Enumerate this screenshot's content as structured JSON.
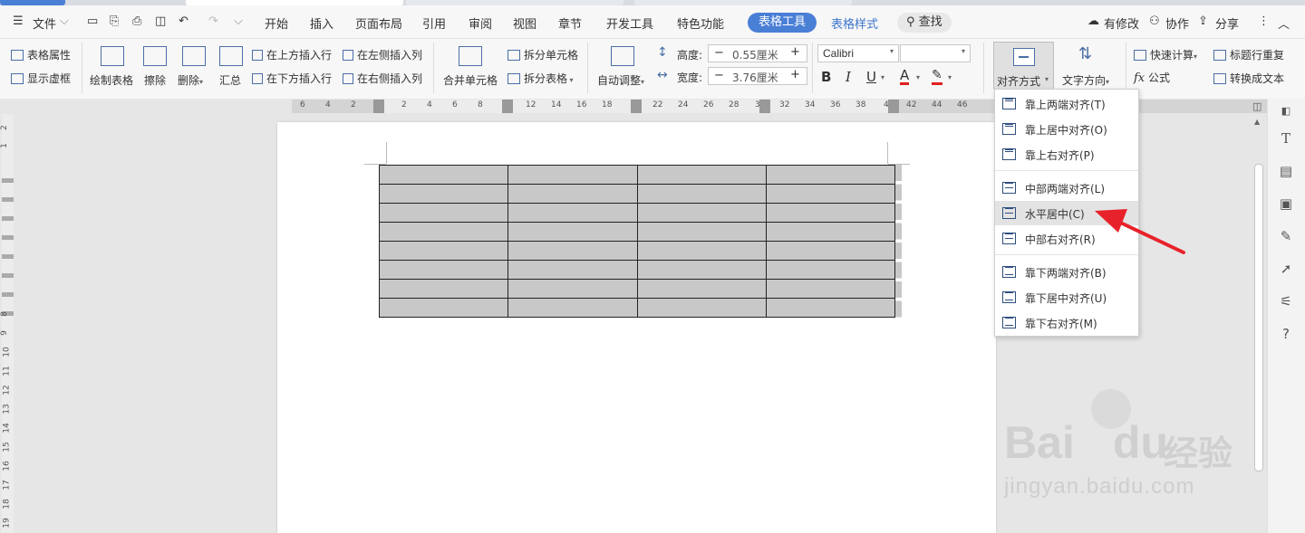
{
  "menubar": {
    "file": "文件",
    "items": [
      "开始",
      "插入",
      "页面布局",
      "引用",
      "审阅",
      "视图",
      "章节",
      "开发工具",
      "特色功能"
    ],
    "active_tab": "表格工具",
    "tab_table_style": "表格样式",
    "search": "查找",
    "has_changes": "有修改",
    "collaborate": "协作",
    "share": "分享"
  },
  "ribbon": {
    "table_props": "表格属性",
    "show_gridlines": "显示虚框",
    "draw_table": "绘制表格",
    "erase": "擦除",
    "delete": "删除",
    "summary": "汇总",
    "insert_row_above": "在上方插入行",
    "insert_row_below": "在下方插入行",
    "insert_col_left": "在左侧插入列",
    "insert_col_right": "在右侧插入列",
    "merge_cells": "合并单元格",
    "split_cells": "拆分单元格",
    "split_table": "拆分表格",
    "auto_adjust": "自动调整",
    "height_label": "高度:",
    "height_value": "0.55厘米",
    "width_label": "宽度:",
    "width_value": "3.76厘米",
    "font_name": "Calibri",
    "font_size": "",
    "bold": "B",
    "italic": "I",
    "underline": "U",
    "font_color": "A",
    "align_mode": "对齐方式",
    "text_direction": "文字方向",
    "quick_calc": "快速计算",
    "formula": "公式",
    "header_repeat": "标题行重复",
    "to_text": "转换成文本"
  },
  "ruler": {
    "h_ticks": [
      "6",
      "4",
      "2",
      "2",
      "4",
      "6",
      "8",
      "12",
      "14",
      "16",
      "18",
      "22",
      "24",
      "26",
      "28",
      "3",
      "32",
      "34",
      "36",
      "38",
      "4",
      "42",
      "44",
      "46"
    ],
    "v_ticks": [
      "2",
      "1",
      "8",
      "9",
      "10",
      "11",
      "12",
      "13",
      "14",
      "15",
      "16",
      "17",
      "18",
      "19"
    ]
  },
  "table": {
    "rows": 8,
    "cols": 4
  },
  "dropdown": {
    "groups": [
      [
        "靠上两端对齐(T)",
        "靠上居中对齐(O)",
        "靠上右对齐(P)"
      ],
      [
        "中部两端对齐(L)",
        "水平居中(C)",
        "中部右对齐(R)"
      ],
      [
        "靠下两端对齐(B)",
        "靠下居中对齐(U)",
        "靠下右对齐(M)"
      ]
    ],
    "highlighted": "水平居中(C)"
  },
  "watermark": {
    "brand": "Bai",
    "brand2": "du",
    "cn": "经验",
    "url": "jingyan.baidu.com"
  },
  "colors": {
    "accent": "#4a7fd6",
    "arrow": "#e8222a",
    "cell_fill": "#c8c8c8"
  }
}
